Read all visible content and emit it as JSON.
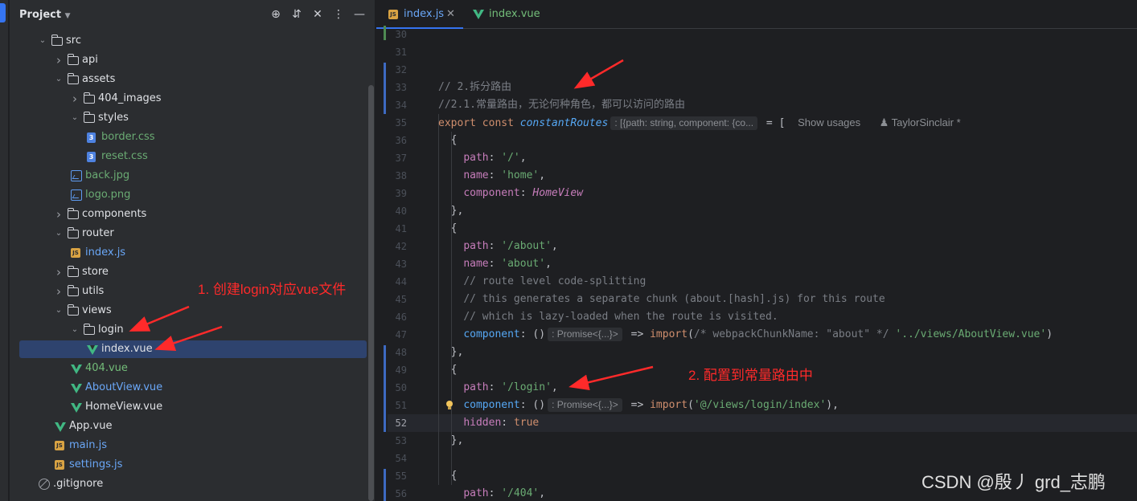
{
  "project_panel": {
    "title": "Project",
    "tree": [
      {
        "label": "src",
        "type": "folder",
        "expanded": true,
        "depth": 0
      },
      {
        "label": "api",
        "type": "folder",
        "expanded": false,
        "depth": 1
      },
      {
        "label": "assets",
        "type": "folder",
        "expanded": true,
        "depth": 1
      },
      {
        "label": "404_images",
        "type": "folder",
        "expanded": false,
        "depth": 2
      },
      {
        "label": "styles",
        "type": "folder",
        "expanded": true,
        "depth": 2
      },
      {
        "label": "border.css",
        "type": "css",
        "depth": 3
      },
      {
        "label": "reset.css",
        "type": "css",
        "depth": 3
      },
      {
        "label": "back.jpg",
        "type": "image",
        "depth": 2
      },
      {
        "label": "logo.png",
        "type": "image",
        "depth": 2
      },
      {
        "label": "components",
        "type": "folder",
        "expanded": false,
        "depth": 1
      },
      {
        "label": "router",
        "type": "folder",
        "expanded": true,
        "depth": 1
      },
      {
        "label": "index.js",
        "type": "js",
        "depth": 2
      },
      {
        "label": "store",
        "type": "folder",
        "expanded": false,
        "depth": 1
      },
      {
        "label": "utils",
        "type": "folder",
        "expanded": false,
        "depth": 1
      },
      {
        "label": "views",
        "type": "folder",
        "expanded": true,
        "depth": 1
      },
      {
        "label": "login",
        "type": "folder",
        "expanded": true,
        "depth": 2
      },
      {
        "label": "index.vue",
        "type": "vue",
        "depth": 3,
        "selected": true
      },
      {
        "label": "404.vue",
        "type": "vue",
        "depth": 2
      },
      {
        "label": "AboutView.vue",
        "type": "vue",
        "depth": 2
      },
      {
        "label": "HomeView.vue",
        "type": "vue",
        "depth": 2
      },
      {
        "label": "App.vue",
        "type": "vue",
        "depth": 1
      },
      {
        "label": "main.js",
        "type": "js",
        "depth": 1
      },
      {
        "label": "settings.js",
        "type": "js",
        "depth": 1
      },
      {
        "label": ".gitignore",
        "type": "ignore",
        "depth": 0
      }
    ]
  },
  "tabs": [
    {
      "label": "index.js",
      "icon": "js-file-icon",
      "active": true
    },
    {
      "label": "index.vue",
      "icon": "vue-file-icon",
      "active": false
    }
  ],
  "editor": {
    "line_numbers": [
      "30",
      "31",
      "32",
      "33",
      "34",
      "35",
      "36",
      "37",
      "38",
      "39",
      "40",
      "41",
      "42",
      "43",
      "44",
      "45",
      "46",
      "47",
      "48",
      "49",
      "50",
      "51",
      "52",
      "53",
      "54",
      "55",
      "56"
    ],
    "current_line": "52",
    "inlay_type_hint": ": [{path: string, component: {co...",
    "inlay_promise": ": Promise<{...}>",
    "show_usages": "Show usages",
    "author": "TaylorSinclair *"
  },
  "annotations": {
    "step1": "1. 创建login对应vue文件",
    "step2": "2. 配置到常量路由中"
  },
  "watermark": "CSDN @殷丿 grd_志鹏",
  "colors": {
    "accent": "#3574f0",
    "annotation_red": "#ff2a2a",
    "selection": "#2e436e"
  }
}
